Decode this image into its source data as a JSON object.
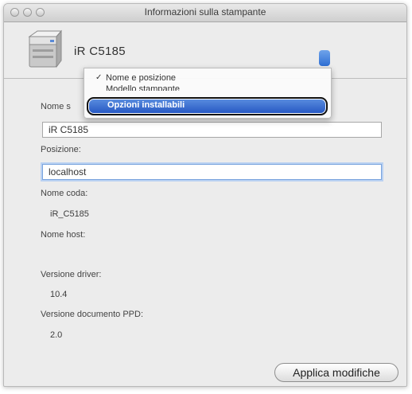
{
  "window": {
    "title": "Informazioni sulla stampante"
  },
  "printer": {
    "name": "iR C5185"
  },
  "menu": {
    "items": [
      {
        "label": "Nome e posizione",
        "checked": true
      },
      {
        "label": "Modello stampante",
        "checked": false
      },
      {
        "label": "Opzioni installabili",
        "checked": false,
        "selected": true
      }
    ]
  },
  "form": {
    "name_label": "Nome stampante:",
    "name_label_visible": "Nome s",
    "name_value": "iR C5185",
    "location_label": "Posizione:",
    "location_value": "localhost",
    "queue_label": "Nome coda:",
    "queue_value": "iR_C5185",
    "host_label": "Nome host:",
    "driver_label": "Versione driver:",
    "driver_value": "10.4",
    "ppd_label": "Versione documento PPD:",
    "ppd_value": "2.0"
  },
  "buttons": {
    "apply_label": "Applica modifiche"
  },
  "colors": {
    "selection": "#2f64cc",
    "focus_ring": "#b9d1f2",
    "window_bg": "#ececec"
  }
}
